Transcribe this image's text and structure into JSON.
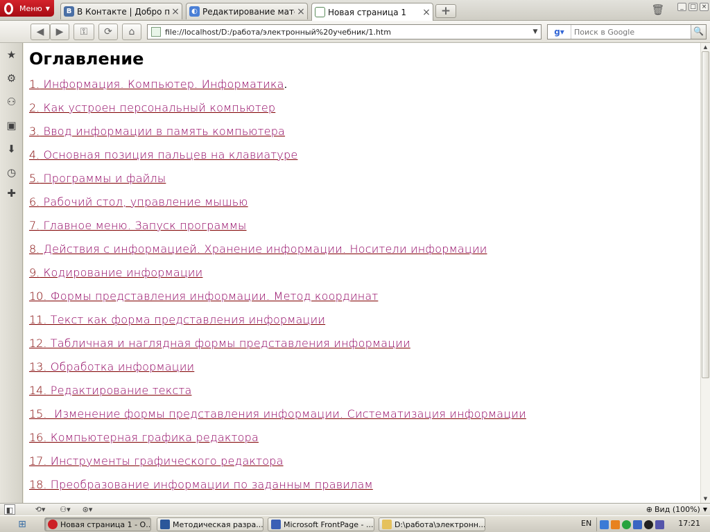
{
  "browser": {
    "menu_label": "Меню",
    "tabs": [
      {
        "label": "В Контакте | Добро по...",
        "icon_text": "В",
        "icon_color": "#4a6fa5"
      },
      {
        "label": "Редактирование матер...",
        "icon_text": "◐",
        "icon_color": "#4a7fd6"
      },
      {
        "label": "Новая страница 1",
        "icon_text": "",
        "icon_color": "#5a8a5a"
      }
    ],
    "new_tab_symbol": "+",
    "trash_icon": "trash-icon",
    "window_buttons": [
      "_",
      "□",
      "×"
    ]
  },
  "toolbar": {
    "back": "◀",
    "forward": "▶",
    "key": "⚿",
    "reload": "⟳",
    "home": "⌂",
    "address": "file://localhost/D:/работа/электронный%20учебник/1.htm",
    "address_dropdown": "▼",
    "search_placeholder": "Поиск в Google",
    "search_engine_icon": "g",
    "search_button": "🔍"
  },
  "side_panel": {
    "icons": [
      "bookmarks-icon",
      "widgets-icon",
      "unite-icon",
      "notes-icon",
      "downloads-icon",
      "history-icon",
      "add-panel-icon"
    ],
    "glyphs": [
      "★",
      "⚙",
      "⚇",
      "▣",
      "⬇",
      "◷",
      "✚"
    ]
  },
  "content": {
    "heading": "Оглавление",
    "items": [
      {
        "num": "1.",
        "text": " Информация. Компьютер. Информатика",
        "suffix": "."
      },
      {
        "num": "2.",
        "text": " Как устроен персональный компьютер",
        "suffix": ""
      },
      {
        "num": "3.",
        "text": " Ввод информации в память компьютера",
        "suffix": ""
      },
      {
        "num": "4.",
        "text": " Основная позиция пальцев на клавиатуре",
        "suffix": ""
      },
      {
        "num": "5.",
        "text": " Программы и файлы",
        "suffix": ""
      },
      {
        "num": "6.",
        "text": " Рабочий стол, управление мышью",
        "suffix": ""
      },
      {
        "num": "7.",
        "text": " Главное меню. Запуск программы",
        "suffix": ""
      },
      {
        "num": "8.",
        "text": " Действия с информацией. Хранение информации. Носители информации",
        "suffix": ""
      },
      {
        "num": "9.",
        "text": " Кодирование информации",
        "suffix": ""
      },
      {
        "num": "10.",
        "text": " Формы представления информации. Метод координат",
        "suffix": ""
      },
      {
        "num": "11.",
        "text": " Текст как форма представления информации",
        "suffix": ""
      },
      {
        "num": "12.",
        "text": " Табличная и наглядная формы представления информации",
        "suffix": ""
      },
      {
        "num": "13.",
        "text": " Обработка информации",
        "suffix": ""
      },
      {
        "num": "14.",
        "text": " Редактирование текста",
        "suffix": ""
      },
      {
        "num": "15.",
        "text": "  Изменение формы представления информации. Систематизация информации",
        "suffix": ""
      },
      {
        "num": "16.",
        "text": " Компьютерная графика редактора",
        "suffix": ""
      },
      {
        "num": "17.",
        "text": " Инструменты графического редактора",
        "suffix": ""
      },
      {
        "num": "18.",
        "text": " Преобразование информации по заданным правилам",
        "suffix": ""
      }
    ]
  },
  "statusbar": {
    "zoom_label": "Вид (100%)",
    "zoom_arrow": "▼"
  },
  "taskbar": {
    "tasks": [
      {
        "label": "Новая страница 1 - О...",
        "icon_color": "#cc1f25"
      },
      {
        "label": "Методическая разра...",
        "icon_color": "#2b579a"
      },
      {
        "label": "Microsoft FrontPage - ...",
        "icon_color": "#3b5fb5"
      },
      {
        "label": "D:\\работа\\электронн...",
        "icon_color": "#e5c15c"
      }
    ],
    "lang": "EN",
    "tray_colors": [
      "#3b7bd6",
      "#e8821e",
      "#27a33e",
      "#3a66c2",
      "#222222",
      "#5555aa"
    ],
    "clock": "17:21"
  }
}
